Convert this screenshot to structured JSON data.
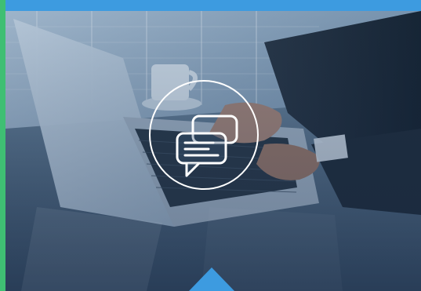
{
  "card": {
    "accent_top_color": "#3d9be0",
    "accent_left_color": "#3fbf73",
    "pointer_color": "#3d9be0"
  },
  "hero": {
    "scene": "person-typing-on-laptop-photo",
    "badge_icon": "chat-bubbles-icon"
  }
}
